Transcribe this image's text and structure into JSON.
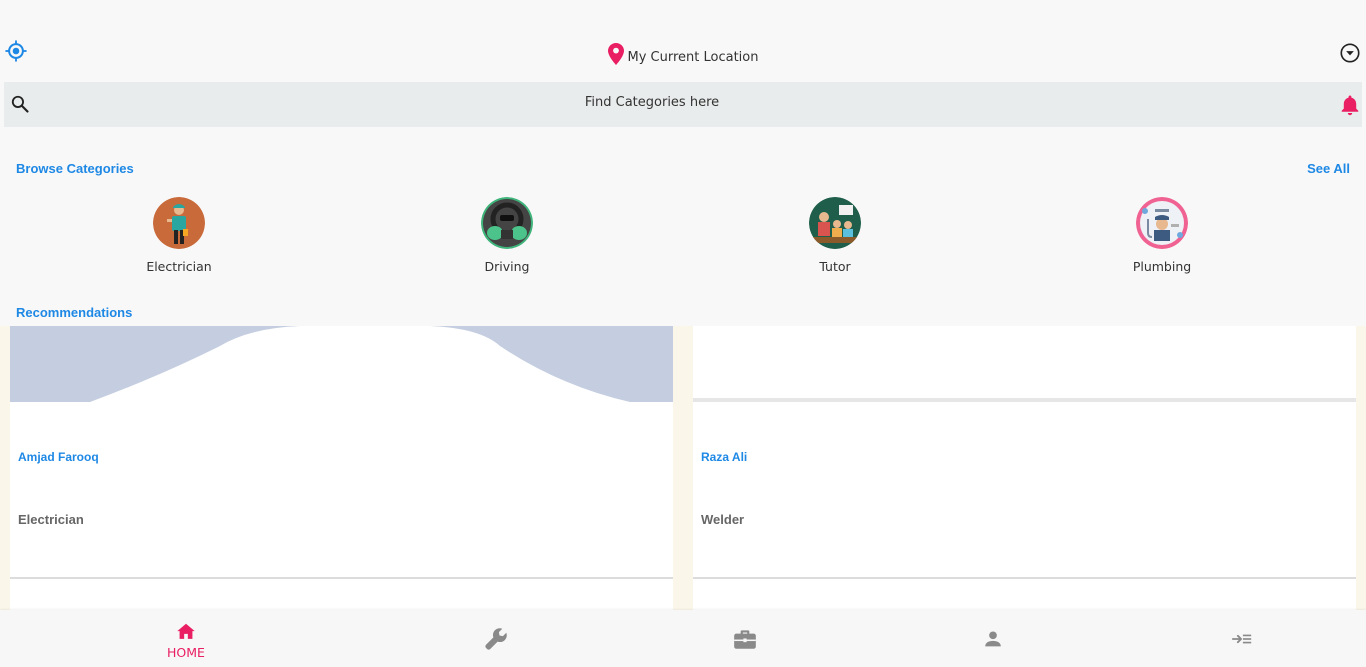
{
  "location": {
    "text": "My Current Location"
  },
  "search": {
    "placeholder": "Find Categories here"
  },
  "browse": {
    "title": "Browse Categories",
    "see_all": "See All",
    "categories": [
      {
        "label": "Electrician",
        "icon": "electrician-avatar"
      },
      {
        "label": "Driving",
        "icon": "driving-avatar"
      },
      {
        "label": "Tutor",
        "icon": "tutor-avatar"
      },
      {
        "label": "Plumbing",
        "icon": "plumbing-avatar"
      }
    ]
  },
  "recommendations": {
    "title": "Recommendations",
    "items": [
      {
        "name": "Amjad Farooq",
        "profession": "Electrician"
      },
      {
        "name": "Raza Ali",
        "profession": "Welder"
      }
    ]
  },
  "nav": {
    "items": [
      {
        "label": "HOME",
        "icon": "home-icon",
        "active": true
      },
      {
        "label": "",
        "icon": "wrench-icon",
        "active": false
      },
      {
        "label": "",
        "icon": "briefcase-icon",
        "active": false
      },
      {
        "label": "",
        "icon": "person-icon",
        "active": false
      },
      {
        "label": "",
        "icon": "logout-icon",
        "active": false
      }
    ]
  },
  "colors": {
    "accent": "#1e88e5",
    "pink": "#e91e63",
    "search_bg": "#e9ecec",
    "nav_inactive": "#8a8a8a"
  }
}
